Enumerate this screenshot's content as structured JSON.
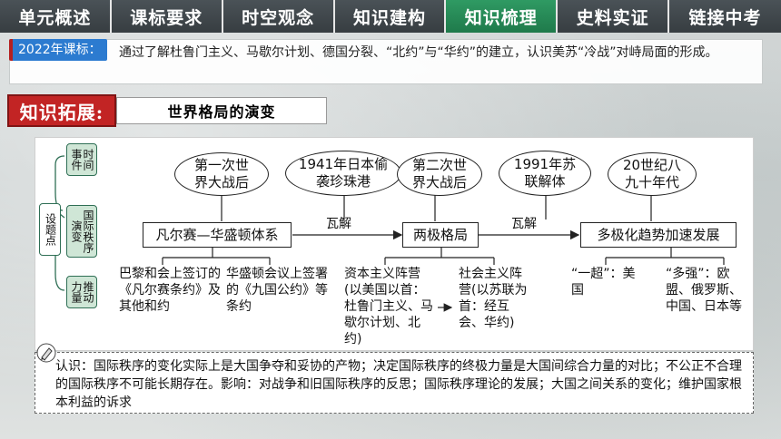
{
  "tabs": [
    {
      "label": "单元概述"
    },
    {
      "label": "课标要求"
    },
    {
      "label": "时空观念"
    },
    {
      "label": "知识建构"
    },
    {
      "label": "知识梳理"
    },
    {
      "label": "史料实证"
    },
    {
      "label": "链接中考"
    }
  ],
  "active_tab": "知识梳理",
  "standard": {
    "tag": "2022年课标：",
    "text": "通过了解杜鲁门主义、马歇尔计划、德国分裂、“北约”与“华约”的建立，认识美苏“冷战”对峙局面的形成。"
  },
  "extension": {
    "label": "知识拓展:",
    "title": "世界格局的演变"
  },
  "diagram": {
    "side_main": "设题点",
    "side_items": [
      "时间事件",
      "国际秩序演变",
      "推动力量"
    ],
    "ellipses": [
      "第一次世界大战后",
      "1941年日本偷袭珍珠港",
      "第二次世界大战后",
      "1991年苏联解体",
      "20世纪八九十年代"
    ],
    "stages": [
      "凡尔赛—华盛顿体系",
      "两极格局",
      "多极化趋势加速发展"
    ],
    "arrow_labels": [
      "瓦解",
      "瓦解"
    ],
    "details": {
      "paris": "巴黎和会上签订的《凡尔赛条约》及其他和约",
      "washington": "华盛顿会议上签署的《九国公约》等条约",
      "capitalist": "资本主义阵营(以美国以首：杜鲁门主义、马歇尔计划、北约)",
      "socialist": "社会主义阵营(以苏联为首：经互会、华约)",
      "superpower": "“一超”：美国",
      "powers": "“多强”：欧盟、俄罗斯、中国、日本等"
    }
  },
  "conclusion": "认识：国际秩序的变化实际上是大国争夺和妥协的产物；决定国际秩序的终极力量是大国间综合力量的对比；不公正不合理的国际秩序不可能长期存在。影响：对战争和旧国际秩序的反思；国际秩序理论的发展；大国之间关系的变化；维护国家根本利益的诉求",
  "colors": {
    "tab_bg": "#3e4549",
    "tab_active": "#2a8a59",
    "tag_blue": "#2c7bd0",
    "ext_red": "#c22424"
  }
}
